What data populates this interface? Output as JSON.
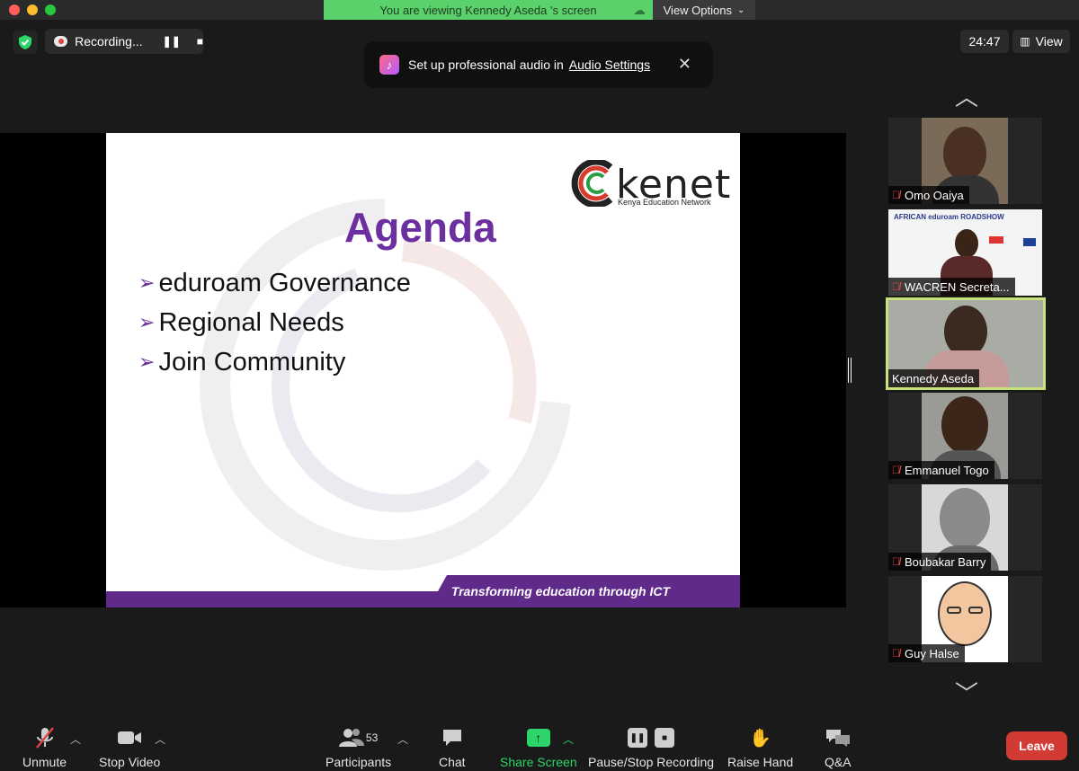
{
  "titlebar": {
    "viewing_banner": "You are viewing Kennedy Aseda 's screen",
    "view_options": "View Options"
  },
  "top_controls": {
    "recording_label": "Recording...",
    "timer": "24:47",
    "view_label": "View"
  },
  "audio_toast": {
    "text": "Set up professional audio in",
    "link": "Audio Settings"
  },
  "slide": {
    "logo_word": "kenet",
    "logo_sub": "Kenya Education Network",
    "title": "Agenda",
    "items": [
      "eduroam Governance",
      "Regional Needs",
      "Join Community"
    ],
    "footer": "Transforming education through ICT"
  },
  "gallery": {
    "participants": [
      {
        "name": "Omo Oaiya",
        "muted": true
      },
      {
        "name": "WACREN Secreta...",
        "muted": true,
        "background_text": "AFRICAN eduroam ROADSHOW"
      },
      {
        "name": "Kennedy Aseda",
        "muted": false,
        "active_speaker": true
      },
      {
        "name": "Emmanuel Togo",
        "muted": true
      },
      {
        "name": "Boubakar Barry",
        "muted": true
      },
      {
        "name": "Guy Halse",
        "muted": true
      }
    ]
  },
  "toolbar": {
    "unmute": "Unmute",
    "stop_video": "Stop Video",
    "participants": "Participants",
    "participants_count": "53",
    "chat": "Chat",
    "share_screen": "Share Screen",
    "pause_stop_recording": "Pause/Stop Recording",
    "raise_hand": "Raise Hand",
    "qa": "Q&A",
    "leave": "Leave"
  },
  "colors": {
    "accent_green": "#5bd16c",
    "leave_red": "#d23a34",
    "slide_purple": "#6b2fa0",
    "active_speaker_border": "#c7e27a"
  }
}
